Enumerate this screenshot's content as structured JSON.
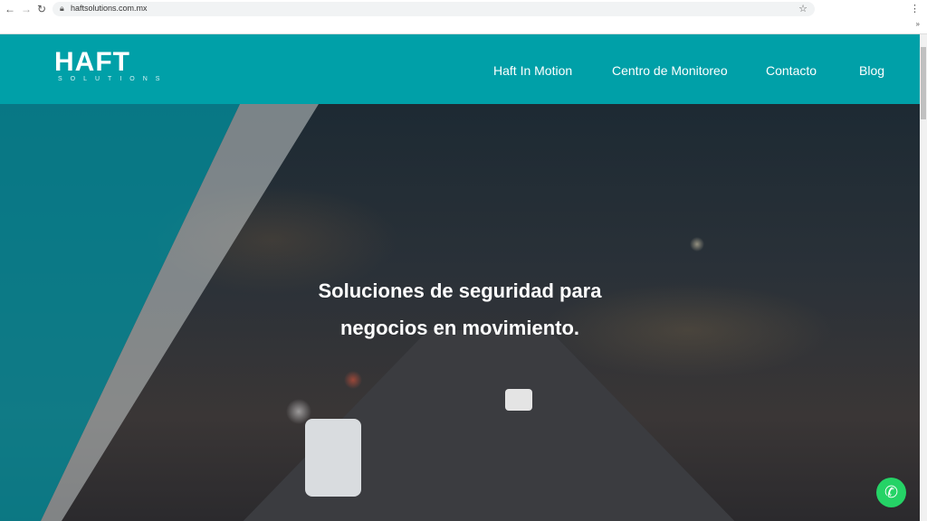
{
  "browser": {
    "url": "haftsolutions.com.mx",
    "back_icon": "arrow-left",
    "forward_icon": "arrow-right",
    "reload_icon": "reload",
    "lock_icon": "lock",
    "star_icon": "star",
    "menu_icon": "kebab",
    "extensions_icon": "chevron-double-right"
  },
  "header": {
    "logo": {
      "main": "HAFT",
      "sub": "SOLUTIONS"
    },
    "nav": [
      {
        "label": "Haft In Motion"
      },
      {
        "label": "Centro de Monitoreo"
      },
      {
        "label": "Contacto"
      },
      {
        "label": "Blog"
      }
    ],
    "color": "#00a0a8"
  },
  "hero": {
    "line1": "Soluciones de seguridad para",
    "line2": "negocios en movimiento."
  },
  "whatsapp": {
    "icon": "whatsapp"
  }
}
